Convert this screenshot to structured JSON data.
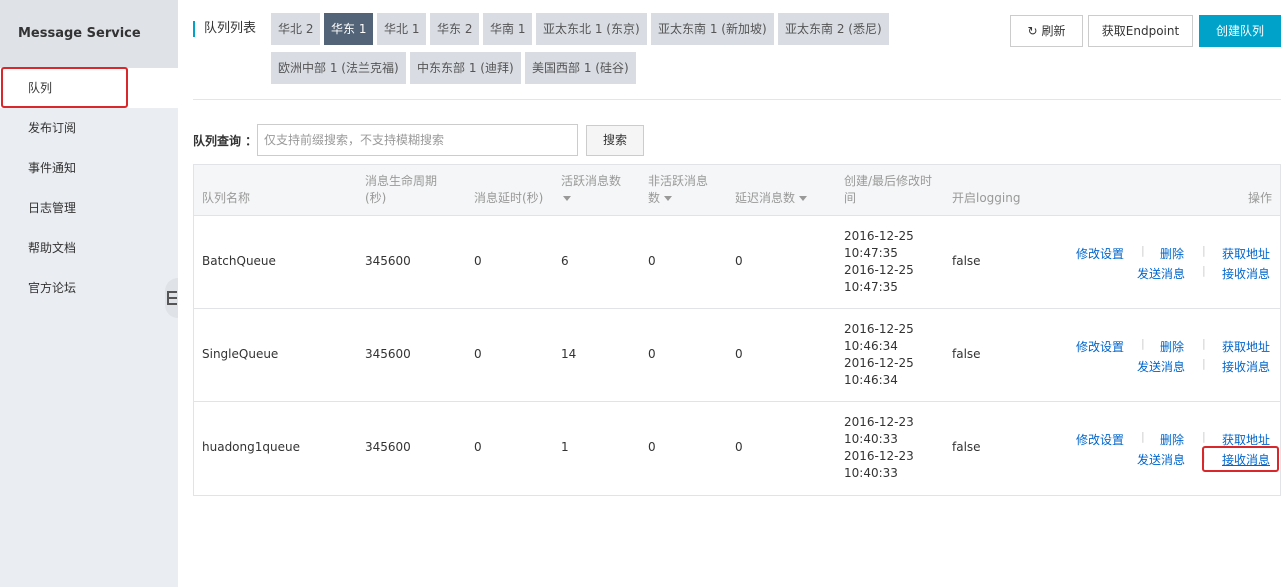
{
  "sidebar": {
    "title": "Message Service",
    "items": [
      {
        "label": "队列"
      },
      {
        "label": "发布订阅"
      },
      {
        "label": "事件通知"
      },
      {
        "label": "日志管理"
      },
      {
        "label": "帮助文档"
      },
      {
        "label": "官方论坛"
      }
    ]
  },
  "header": {
    "list_label": "队列列表",
    "regions": [
      "华北 2",
      "华东 1",
      "华北 1",
      "华东 2",
      "华南 1",
      "亚太东北 1 (东京)",
      "亚太东南 1 (新加坡)",
      "亚太东南 2 (悉尼)",
      "欧洲中部 1 (法兰克福)",
      "中东东部 1 (迪拜)",
      "美国西部 1 (硅谷)"
    ],
    "active_region": "华东 1",
    "refresh_label": "刷新",
    "endpoint_label": "获取Endpoint",
    "create_label": "创建队列"
  },
  "search": {
    "label": "队列查询 ：",
    "placeholder": "仅支持前缀搜索，不支持模糊搜索",
    "button": "搜索"
  },
  "table": {
    "columns": {
      "name": "队列名称",
      "lifecycle_1": "消息生命周期",
      "lifecycle_2": "(秒)",
      "delay": "消息延时(秒)",
      "active_1": "活跃消息数",
      "inactive_1": "非活跃消息",
      "inactive_2": "数",
      "delayed": "延迟消息数",
      "time_1": "创建/最后修改时",
      "time_2": "间",
      "logging": "开启logging",
      "ops": "操作"
    },
    "rows": [
      {
        "name": "BatchQueue",
        "lifecycle": "345600",
        "delay": "0",
        "active": "6",
        "inactive": "0",
        "delayed": "0",
        "created_date": "2016-12-25",
        "created_time": "10:47:35",
        "modified_date": "2016-12-25",
        "modified_time": "10:47:35",
        "logging": "false"
      },
      {
        "name": "SingleQueue",
        "lifecycle": "345600",
        "delay": "0",
        "active": "14",
        "inactive": "0",
        "delayed": "0",
        "created_date": "2016-12-25",
        "created_time": "10:46:34",
        "modified_date": "2016-12-25",
        "modified_time": "10:46:34",
        "logging": "false"
      },
      {
        "name": "huadong1queue",
        "lifecycle": "345600",
        "delay": "0",
        "active": "1",
        "inactive": "0",
        "delayed": "0",
        "created_date": "2016-12-23",
        "created_time": "10:40:33",
        "modified_date": "2016-12-23",
        "modified_time": "10:40:33",
        "logging": "false"
      }
    ],
    "ops": {
      "edit": "修改设置",
      "delete": "删除",
      "get_url": "获取地址",
      "send": "发送消息",
      "receive": "接收消息"
    }
  },
  "colors": {
    "accent": "#00a2ca",
    "active_region": "#546478",
    "highlight": "#d9282c",
    "link": "#0066cc"
  }
}
